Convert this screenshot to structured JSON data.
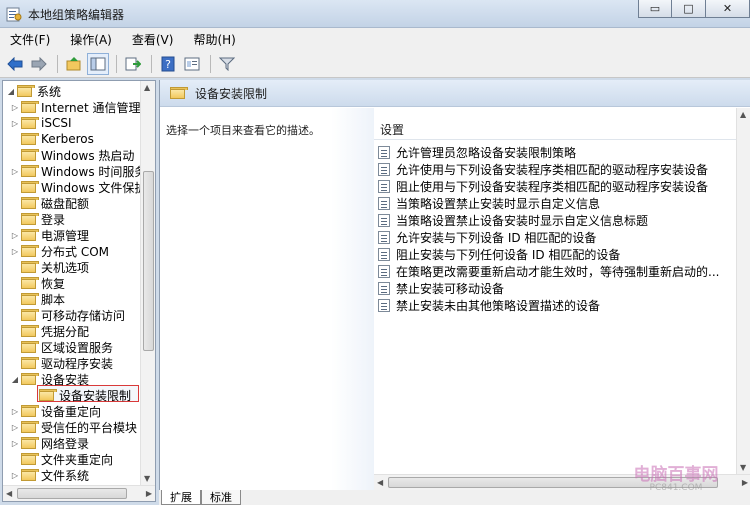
{
  "window": {
    "title": "本地组策略编辑器",
    "buttons": {
      "minimize": "▭",
      "maximize": "□",
      "close": "✕"
    }
  },
  "menu": [
    "文件(F)",
    "操作(A)",
    "查看(V)",
    "帮助(H)"
  ],
  "toolbar": {
    "icons": [
      "back-arrow-icon",
      "forward-arrow-icon",
      "up-folder-icon",
      "show-hide-tree-icon",
      "export-list-icon",
      "help-icon",
      "properties-icon",
      "filter-icon"
    ]
  },
  "tree": {
    "items": [
      {
        "label": "系统",
        "expanded": true
      },
      {
        "label": "Internet 通信管理",
        "has_children": true
      },
      {
        "label": "iSCSI",
        "has_children": true
      },
      {
        "label": "Kerberos",
        "has_children": false
      },
      {
        "label": "Windows 热启动",
        "has_children": false
      },
      {
        "label": "Windows 时间服务",
        "has_children": true
      },
      {
        "label": "Windows 文件保护",
        "has_children": false
      },
      {
        "label": "磁盘配额",
        "has_children": false
      },
      {
        "label": "登录",
        "has_children": false
      },
      {
        "label": "电源管理",
        "has_children": true
      },
      {
        "label": "分布式 COM",
        "has_children": true
      },
      {
        "label": "关机选项",
        "has_children": false
      },
      {
        "label": "恢复",
        "has_children": false
      },
      {
        "label": "脚本",
        "has_children": false
      },
      {
        "label": "可移动存储访问",
        "has_children": false
      },
      {
        "label": "凭据分配",
        "has_children": false
      },
      {
        "label": "区域设置服务",
        "has_children": false
      },
      {
        "label": "驱动程序安装",
        "has_children": false
      },
      {
        "label": "设备安装",
        "expanded": true
      },
      {
        "label": "设备安装限制",
        "selected": true
      },
      {
        "label": "设备重定向",
        "has_children": true
      },
      {
        "label": "受信任的平台模块",
        "has_children": true
      },
      {
        "label": "网络登录",
        "has_children": true
      },
      {
        "label": "文件夹重定向",
        "has_children": false
      },
      {
        "label": "文件系统",
        "has_children": true
      }
    ]
  },
  "main": {
    "header_title": "设备安装限制",
    "description": "选择一个项目来查看它的描述。",
    "column_header": "设置",
    "settings": [
      "允许管理员忽略设备安装限制策略",
      "允许使用与下列设备安装程序类相匹配的驱动程序安装设备",
      "阻止使用与下列设备安装程序类相匹配的驱动程序安装设备",
      "当策略设置禁止安装时显示自定义信息",
      "当策略设置禁止设备安装时显示自定义信息标题",
      "允许安装与下列设备 ID 相匹配的设备",
      "阻止安装与下列任何设备 ID 相匹配的设备",
      "在策略更改需要重新启动才能生效时，等待强制重新启动的...",
      "禁止安装可移动设备",
      "禁止安装未由其他策略设置描述的设备"
    ]
  },
  "tabs": [
    "扩展",
    "标准"
  ],
  "watermark": {
    "main": "电脑百事网",
    "sub": "PC841.COM"
  },
  "colors": {
    "selection_border": "#d93a3a",
    "header_bg": "#cddbec",
    "folder": "#f2c85e"
  }
}
